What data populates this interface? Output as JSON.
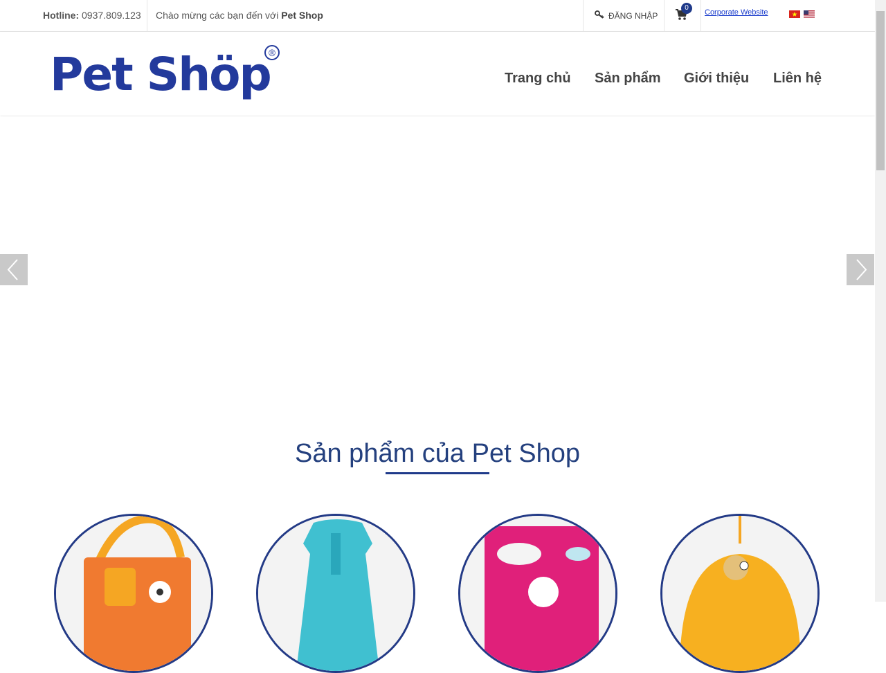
{
  "topbar": {
    "hotline_label": "Hotline:",
    "hotline_number": "0937.809.123",
    "welcome_text": "Chào mừng các bạn đến với ",
    "welcome_brand": "Pet Shop",
    "login_label": "ĐĂNG NHẬP",
    "cart_count": "0",
    "corporate_label": "Corporate Website",
    "flags": [
      "vn-flag-icon",
      "us-flag-icon"
    ]
  },
  "header": {
    "logo_text": "Pet Shöp",
    "logo_mark": "®",
    "nav": [
      "Trang chủ",
      "Sản phẩm",
      "Giới thiệu",
      "Liên hệ"
    ]
  },
  "slider": {
    "prev_icon": "chevron-left-icon",
    "next_icon": "chevron-right-icon"
  },
  "products": {
    "title": "Sản phẩm của Pet Shop",
    "items": [
      "orange-bag",
      "blue-dress",
      "pink-pillow",
      "orange-hanger"
    ]
  },
  "colors": {
    "brand": "#233a86",
    "title": "#24407e",
    "accent_link": "#1a3ccc"
  }
}
